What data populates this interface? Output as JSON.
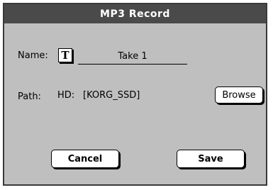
{
  "dialog": {
    "title": "MP3 Record",
    "name_label": "Name:",
    "name_icon": "T",
    "name_value": "Take 1",
    "path_label": "Path:",
    "path_drive": "HD:",
    "path_value": "[KORG_SSD]",
    "browse_label": "Browse",
    "cancel_label": "Cancel",
    "save_label": "Save"
  }
}
